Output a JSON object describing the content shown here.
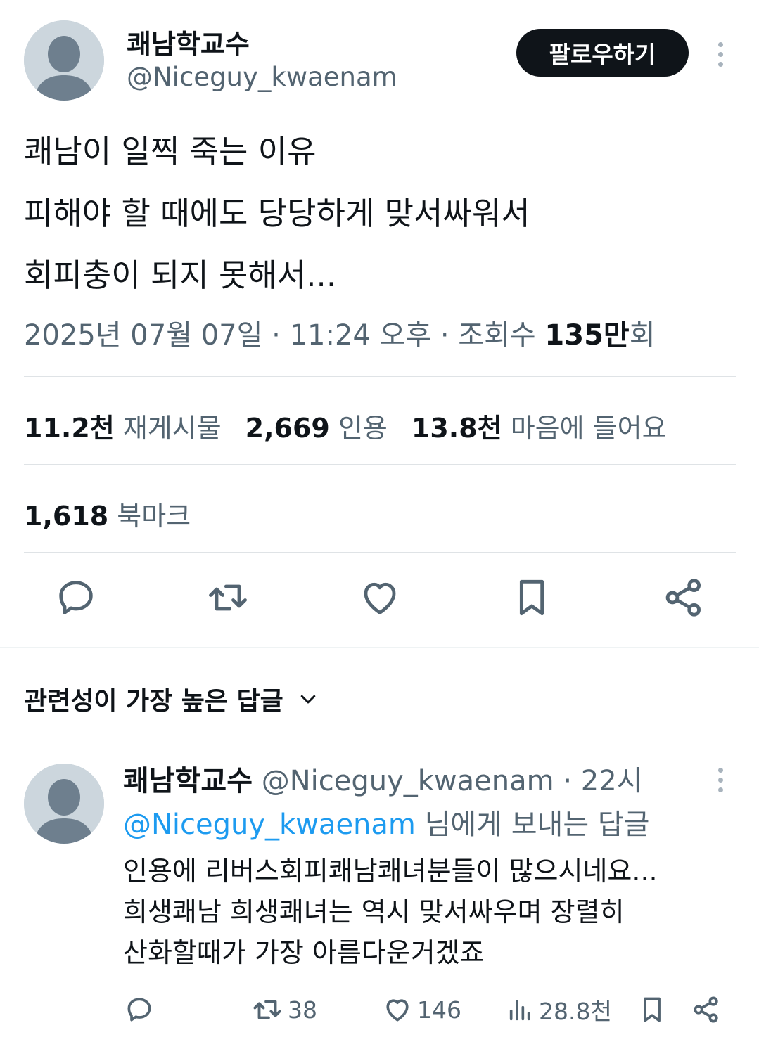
{
  "main_tweet": {
    "author_name": "쾌남학교수",
    "author_handle": "@Niceguy_kwaenam",
    "follow_label": "팔로우하기",
    "text_lines": [
      "쾌남이 일찍 죽는 이유",
      "피해야 할 때에도 당당하게 맞서싸워서",
      "회피충이 되지 못해서..."
    ],
    "meta": {
      "timestamp": "2025년 07월 07일 · 11:24 오후 · 조회수 ",
      "views": "135만",
      "views_suffix": "회"
    },
    "stats": {
      "reposts_count": "11.2천",
      "reposts_label": "재게시물",
      "quotes_count": "2,669",
      "quotes_label": "인용",
      "likes_count": "13.8천",
      "likes_label": "마음에 들어요",
      "bookmarks_count": "1,618",
      "bookmarks_label": "북마크"
    }
  },
  "replies_section": {
    "title": "관련성이 가장 높은 답글"
  },
  "reply": {
    "author_name": "쾌남학교수",
    "author_handle": "@Niceguy_kwaenam · 22시",
    "reply_to_mention": "@Niceguy_kwaenam",
    "reply_to_suffix": " 님에게 보내는 답글",
    "text_lines": [
      "인용에 리버스회피쾌남쾌녀분들이 많으시네요...",
      "희생쾌남 희생쾌녀는 역시 맞서싸우며 장렬히",
      "산화할때가 가장 아름다운거겠죠"
    ],
    "actions": {
      "retweets": "38",
      "likes": "146",
      "views": "28.8천"
    }
  },
  "colors": {
    "text_primary": "#0f1419",
    "text_secondary": "#536471",
    "link": "#1d9bf0",
    "follow_bg": "#0f1419",
    "avatar_bg": "#ccd6dd",
    "avatar_fg": "#6e7f8e"
  },
  "icons": [
    "more-icon",
    "reply-icon",
    "retweet-icon",
    "like-icon",
    "bookmark-icon",
    "share-icon",
    "chevron-down-icon",
    "views-icon"
  ]
}
